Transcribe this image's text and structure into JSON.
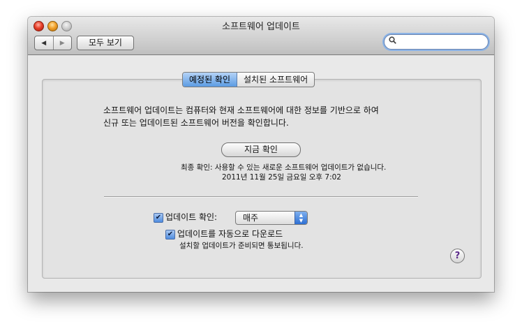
{
  "window": {
    "title": "소프트웨어 업데이트"
  },
  "toolbar": {
    "back_icon": "◀",
    "forward_icon": "▶",
    "show_all_label": "모두 보기",
    "search_icon": "🔍",
    "search_value": "",
    "search_placeholder": ""
  },
  "tabs": [
    {
      "label": "예정된 확인",
      "selected": true
    },
    {
      "label": "설치된 소프트웨어",
      "selected": false
    }
  ],
  "main": {
    "description_line1": "소프트웨어 업데이트는 컴퓨터와 현재 소프트웨어에 대한 정보를 기반으로 하여",
    "description_line2": "신규 또는 업데이트된 소프트웨어 버전을 확인합니다.",
    "check_now_label": "지금 확인",
    "last_check_line1": "최종 확인: 사용할 수 있는 새로운 소프트웨어 업데이트가 없습니다.",
    "last_check_line2": "2011년 11월 25일 금요일 오후 7:02"
  },
  "settings": {
    "check_updates_label": "업데이트 확인:",
    "check_updates_checked": true,
    "frequency_value": "매주",
    "auto_download_label": "업데이트를 자동으로 다운로드",
    "auto_download_checked": true,
    "notify_note": "설치할 업데이트가 준비되면 통보됩니다.",
    "checkmark": "✔"
  },
  "help": {
    "label": "?"
  },
  "colors": {
    "selected_tab": "#5b9be3",
    "checkbox_fill": "#4f8de0",
    "help_glyph": "#5b2a8a"
  }
}
